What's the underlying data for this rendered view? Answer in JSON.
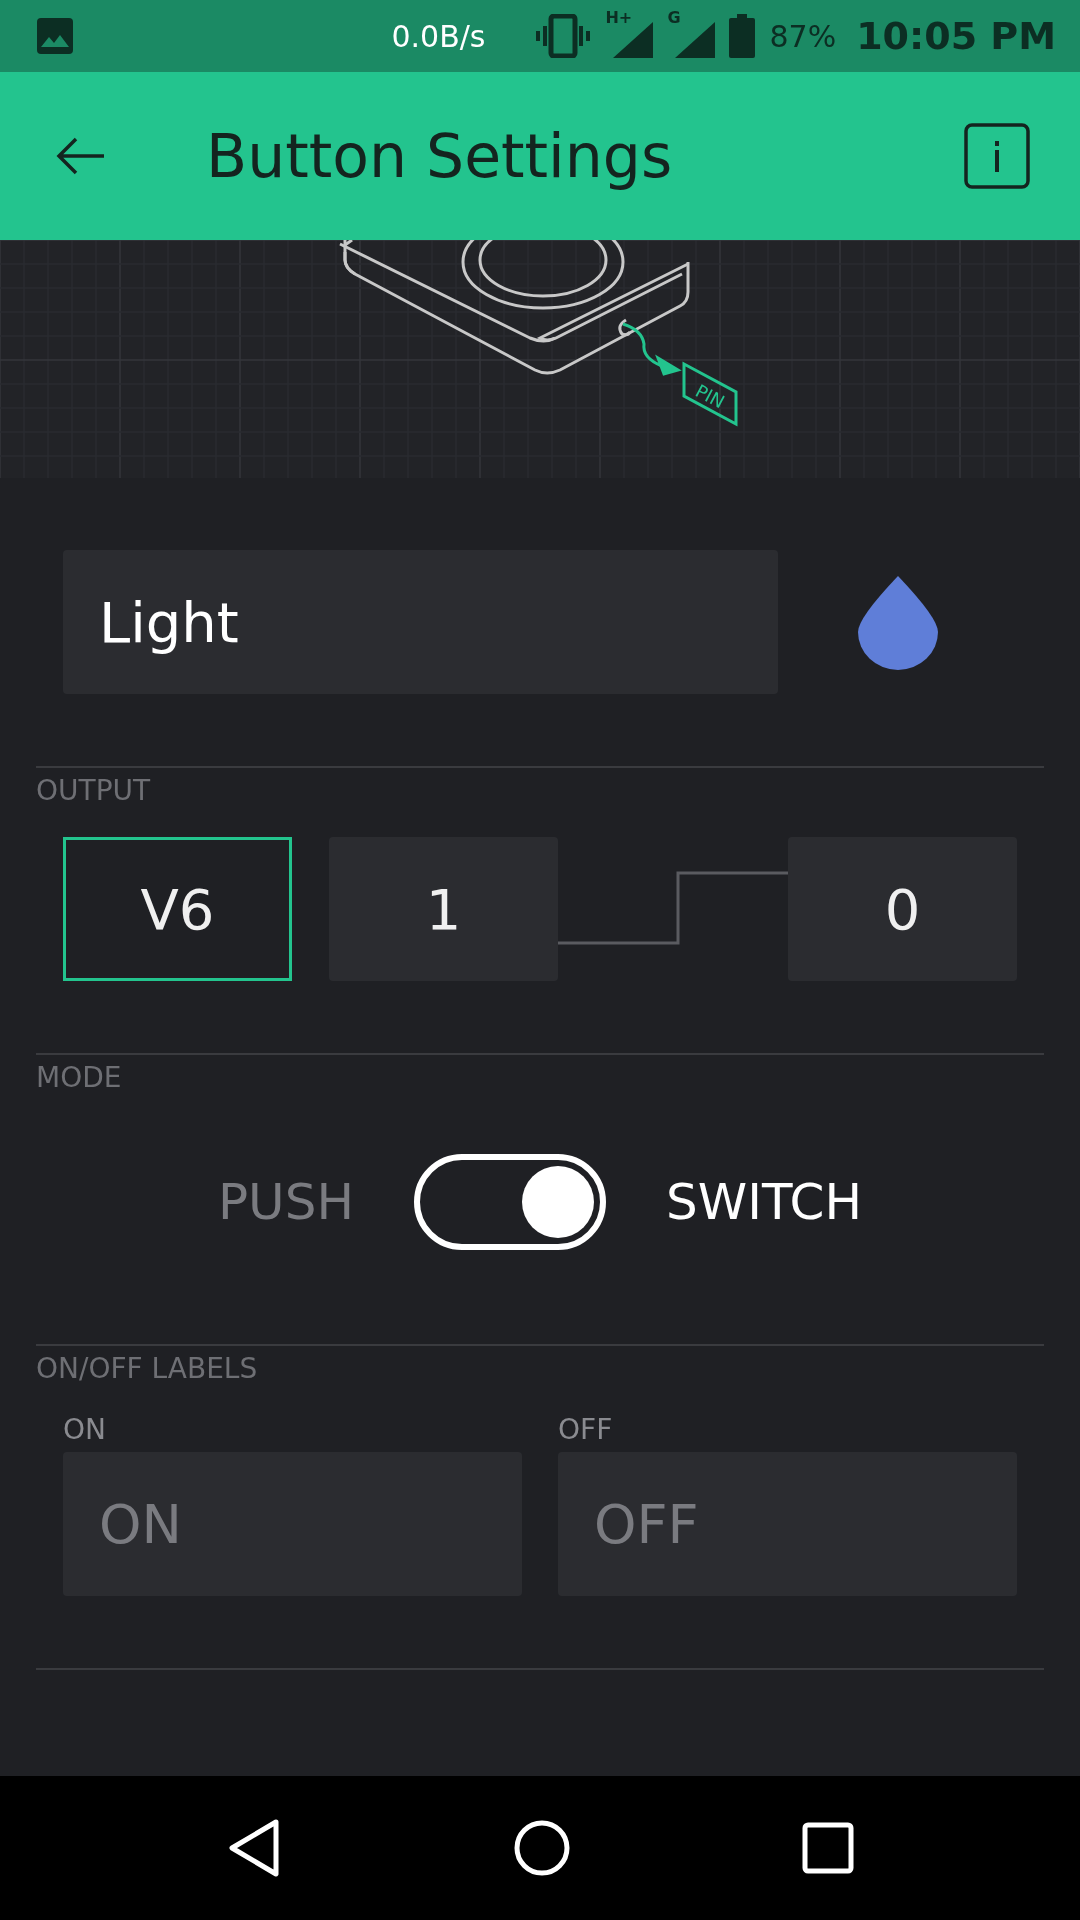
{
  "status_bar": {
    "speed": "0.0B/s",
    "network_1": "H+",
    "network_2": "G",
    "battery": "87%",
    "time": "10:05 PM"
  },
  "app_bar": {
    "title": "Button Settings"
  },
  "illustration": {
    "pin_label": "PIN"
  },
  "name_field": {
    "value": "Light",
    "color": "#5f7ed8"
  },
  "output": {
    "heading": "OUTPUT",
    "pin": {
      "value": "V6",
      "active": true
    },
    "on_value": "1",
    "off_value": "0"
  },
  "mode": {
    "heading": "MODE",
    "options": [
      {
        "label": "PUSH",
        "selected": false
      },
      {
        "label": "SWITCH",
        "selected": true
      }
    ]
  },
  "labels": {
    "heading": "ON/OFF LABELS",
    "fields": [
      {
        "label": "ON",
        "placeholder": "ON"
      },
      {
        "label": "OFF",
        "placeholder": "OFF"
      }
    ]
  }
}
